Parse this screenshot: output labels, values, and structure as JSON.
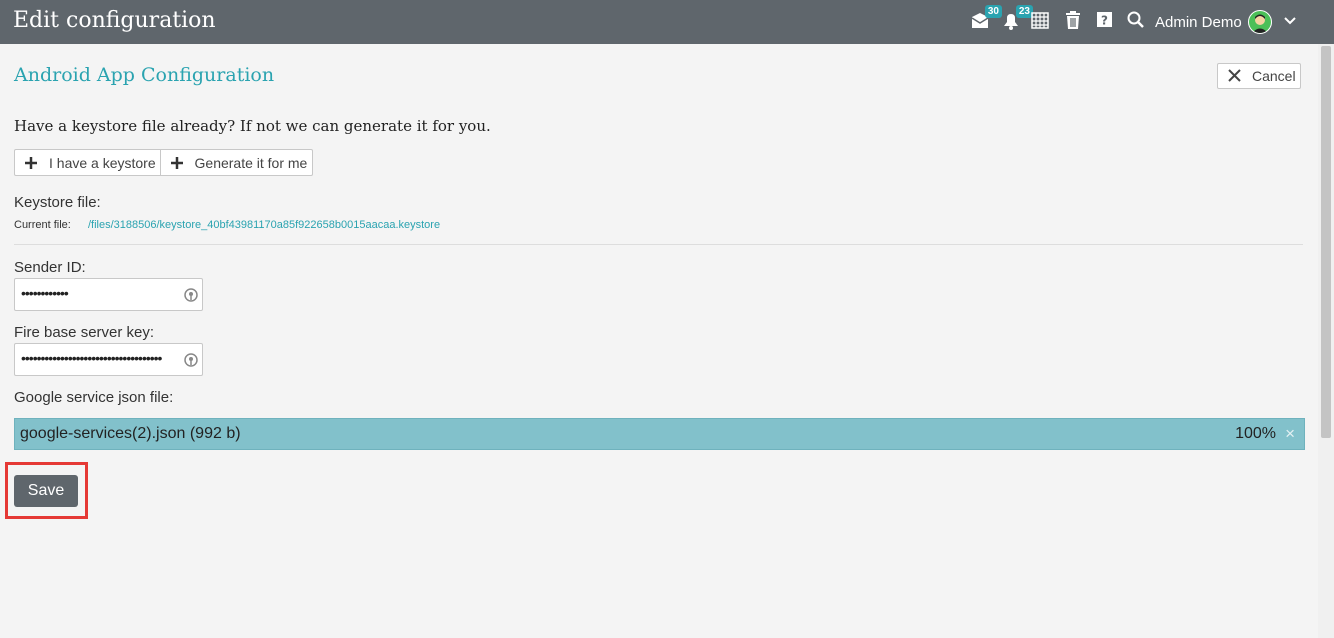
{
  "header": {
    "title": "Edit configuration",
    "messages_badge": "30",
    "notifications_badge": "23",
    "user_name": "Admin Demo"
  },
  "page": {
    "title": "Android App Configuration",
    "cancel_label": "Cancel"
  },
  "keystore": {
    "question": "Have a keystore file already? If not we can generate it for you.",
    "have_label": "I have a keystore",
    "generate_label": "Generate it for me",
    "file_label": "Keystore file:",
    "current_file_label": "Current file:",
    "current_file_path": "/files/3188506/keystore_40bf43981170a85f922658b0015aacaa.keystore"
  },
  "fields": {
    "sender_id_label": "Sender ID:",
    "sender_id_value": "••••••••••••",
    "firebase_key_label": "Fire base server key:",
    "firebase_key_value": "••••••••••••••••••••••••••••••••••••",
    "google_json_label": "Google service json file:"
  },
  "upload": {
    "file_name": "google-services(2).json (992 b)",
    "progress": "100%",
    "remove": "×"
  },
  "actions": {
    "save_label": "Save"
  },
  "colors": {
    "topbar": "#5f666c",
    "accent": "#2aa3b0",
    "upload_bar": "#82c1cb",
    "highlight": "#e53935"
  }
}
